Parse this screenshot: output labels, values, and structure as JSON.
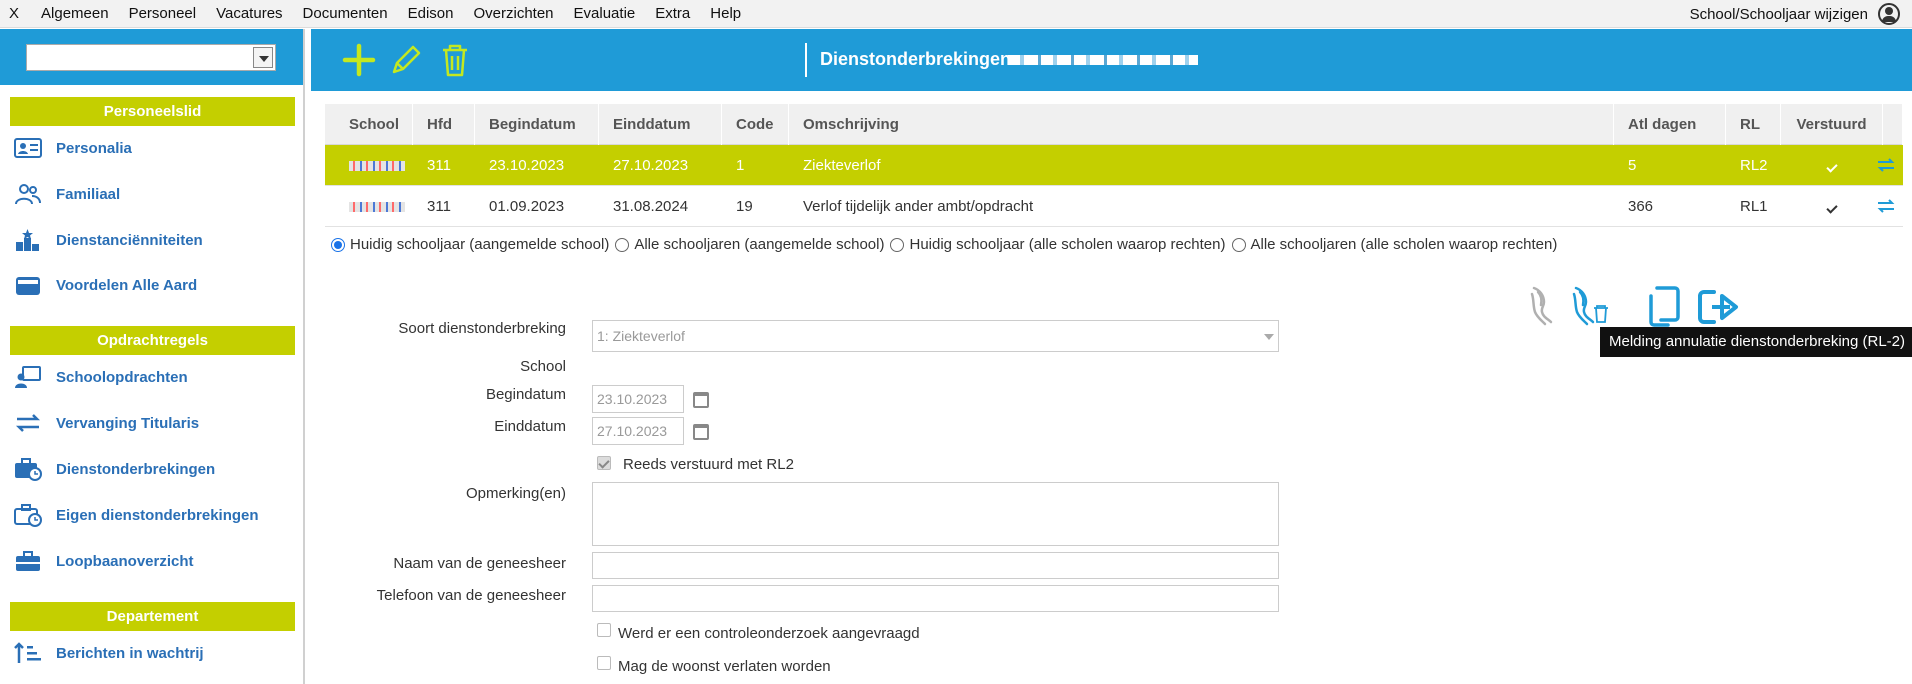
{
  "menu": {
    "items": [
      "X",
      "Algemeen",
      "Personeel",
      "Vacatures",
      "Documenten",
      "Edison",
      "Overzichten",
      "Evaluatie",
      "Extra",
      "Help"
    ],
    "right_label": "School/Schooljaar wijzigen",
    "icons": [
      "user-icon"
    ]
  },
  "sidebar": {
    "select_value": "",
    "sections": [
      {
        "header": "Personeelslid",
        "items": [
          {
            "label": "Personalia",
            "icon": "id-card-icon"
          },
          {
            "label": "Familiaal",
            "icon": "people-icon"
          },
          {
            "label": "Dienstanciënniteiten",
            "icon": "ranking-icon"
          },
          {
            "label": "Voordelen Alle Aard",
            "icon": "wallet-icon"
          }
        ]
      },
      {
        "header": "Opdrachtregels",
        "items": [
          {
            "label": "Schoolopdrachten",
            "icon": "teacher-icon"
          },
          {
            "label": "Vervanging Titularis",
            "icon": "swap-icon"
          },
          {
            "label": "Dienstonderbrekingen",
            "icon": "briefcase-clock-icon"
          },
          {
            "label": "Eigen dienstonderbrekingen",
            "icon": "briefcase-clock-outline-icon"
          },
          {
            "label": "Loopbaanoverzicht",
            "icon": "briefcase-icon"
          }
        ]
      },
      {
        "header": "Departement",
        "items": [
          {
            "label": "Berichten in wachtrij",
            "icon": "sort-list-icon"
          }
        ]
      }
    ]
  },
  "header": {
    "title": "Dienstonderbrekingen",
    "icons": [
      "add-icon",
      "edit-icon",
      "delete-icon"
    ]
  },
  "table": {
    "columns": [
      "School",
      "Hfd",
      "Begindatum",
      "Einddatum",
      "Code",
      "Omschrijving",
      "Atl dagen",
      "RL",
      "Verstuurd"
    ],
    "rows": [
      {
        "hfd": "311",
        "begin": "23.10.2023",
        "end": "27.10.2023",
        "code": "1",
        "omschrijving": "Ziekteverlof",
        "atl": "5",
        "rl": "RL2",
        "verstuurd": true,
        "selected": true
      },
      {
        "hfd": "311",
        "begin": "01.09.2023",
        "end": "31.08.2024",
        "code": "19",
        "omschrijving": "Verlof tijdelijk ander ambt/opdracht",
        "atl": "366",
        "rl": "RL1",
        "verstuurd": true,
        "selected": false
      }
    ]
  },
  "filters": {
    "options": [
      {
        "label": "Huidig schooljaar (aangemelde school)",
        "checked": true
      },
      {
        "label": "Alle schooljaren (aangemelde school)",
        "checked": false
      },
      {
        "label": "Huidig schooljaar (alle scholen waarop rechten)",
        "checked": false
      },
      {
        "label": "Alle schooljaren (alle scholen waarop rechten)",
        "checked": false
      }
    ]
  },
  "form": {
    "soort_label": "Soort dienstonderbreking",
    "soort_value": "1: Ziekteverlof",
    "school_label": "School",
    "begin_label": "Begindatum",
    "begin_value": "23.10.2023",
    "end_label": "Einddatum",
    "end_value": "27.10.2023",
    "reeds_label": "Reeds verstuurd met RL2",
    "opmerking_label": "Opmerking(en)",
    "naam_label": "Naam van de geneesheer",
    "telefoon_label": "Telefoon van de geneesheer",
    "controle_label": "Werd er een controleonderzoek aangevraagd",
    "woonst_label": "Mag de woonst verlaten worden"
  },
  "actions": {
    "icons": [
      "flemish-lion-icon",
      "flemish-lion-delete-icon",
      "copy-icon",
      "export-icon"
    ],
    "tooltip": "Melding annulatie dienstonderbreking (RL-2)"
  },
  "colors": {
    "brand_blue": "#1f9bd7",
    "accent_green": "#c4cf00",
    "link_blue": "#2a6fb6"
  }
}
